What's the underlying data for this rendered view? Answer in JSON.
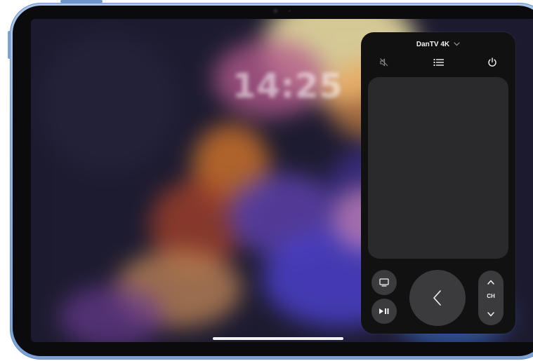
{
  "lock_screen": {
    "time": "14:25"
  },
  "remote": {
    "device_name": "DanTV 4K",
    "channel_label": "CH",
    "icons": {
      "device_chevron": "chevron-down-icon",
      "mute": "speaker-mute-icon",
      "guide": "list-icon",
      "power": "power-icon",
      "tv": "tv-icon",
      "play_pause": "play-pause-icon",
      "back": "chevron-left-icon",
      "channel_up": "chevron-up-icon",
      "channel_down": "chevron-down-icon"
    }
  },
  "colors": {
    "remote_background": "#111112",
    "touchpad": "#2a2a2c",
    "button": "#3b3b3e",
    "ipad_frame": "#8fb3e0"
  }
}
